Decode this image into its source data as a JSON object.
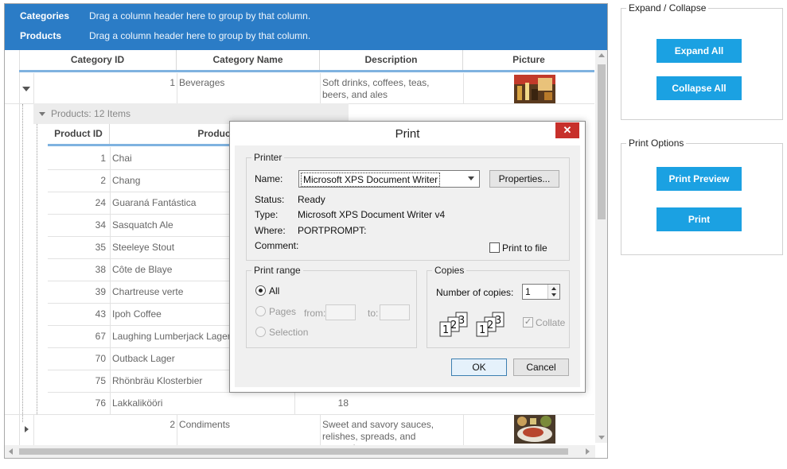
{
  "group_panel": [
    {
      "title": "Categories",
      "hint": "Drag a column header here to group by that column."
    },
    {
      "title": "Products",
      "hint": "Drag a column header here to group by that column."
    }
  ],
  "columns": [
    "Category ID",
    "Category Name",
    "Description",
    "Picture"
  ],
  "categories": [
    {
      "id": "1",
      "name": "Beverages",
      "description": "Soft drinks, coffees, teas, beers, and ales",
      "expanded": true
    },
    {
      "id": "2",
      "name": "Condiments",
      "description": "Sweet and savory sauces, relishes, spreads, and seasonings",
      "expanded": false
    }
  ],
  "products_group_label": "Products: 12 Items",
  "product_columns": [
    "Product ID",
    "Product Name"
  ],
  "products": [
    {
      "id": "1",
      "name": "Chai"
    },
    {
      "id": "2",
      "name": "Chang"
    },
    {
      "id": "24",
      "name": "Guaraná Fantástica"
    },
    {
      "id": "34",
      "name": "Sasquatch Ale"
    },
    {
      "id": "35",
      "name": "Steeleye Stout"
    },
    {
      "id": "38",
      "name": "Côte de Blaye"
    },
    {
      "id": "39",
      "name": "Chartreuse verte"
    },
    {
      "id": "43",
      "name": "Ipoh Coffee"
    },
    {
      "id": "67",
      "name": "Laughing Lumberjack Lager"
    },
    {
      "id": "70",
      "name": "Outback Lager"
    },
    {
      "id": "75",
      "name": "Rhönbräu Klosterbier"
    },
    {
      "id": "76",
      "name": "Lakkalikööri"
    }
  ],
  "last_product_extra": "18",
  "expand_panel": {
    "legend": "Expand / Collapse",
    "expand_all": "Expand All",
    "collapse_all": "Collapse All"
  },
  "print_panel": {
    "legend": "Print Options",
    "print_preview": "Print Preview",
    "print": "Print"
  },
  "dialog": {
    "title": "Print",
    "close": "✕",
    "printer_legend": "Printer",
    "name_label": "Name:",
    "printer_name": "Microsoft XPS Document Writer",
    "properties": "Properties...",
    "status_label": "Status:",
    "status": "Ready",
    "type_label": "Type:",
    "type": "Microsoft XPS Document Writer v4",
    "where_label": "Where:",
    "where": "PORTPROMPT:",
    "comment_label": "Comment:",
    "print_to_file": "Print to file",
    "range_legend": "Print range",
    "all": "All",
    "pages": "Pages",
    "from": "from:",
    "to": "to:",
    "selection": "Selection",
    "copies_legend": "Copies",
    "num_copies_label": "Number of copies:",
    "num_copies": "1",
    "collate": "Collate",
    "ok": "OK",
    "cancel": "Cancel"
  },
  "colors": {
    "accent": "#1ba1e2",
    "group_panel": "#2b7cc6",
    "close": "#c7302b"
  }
}
